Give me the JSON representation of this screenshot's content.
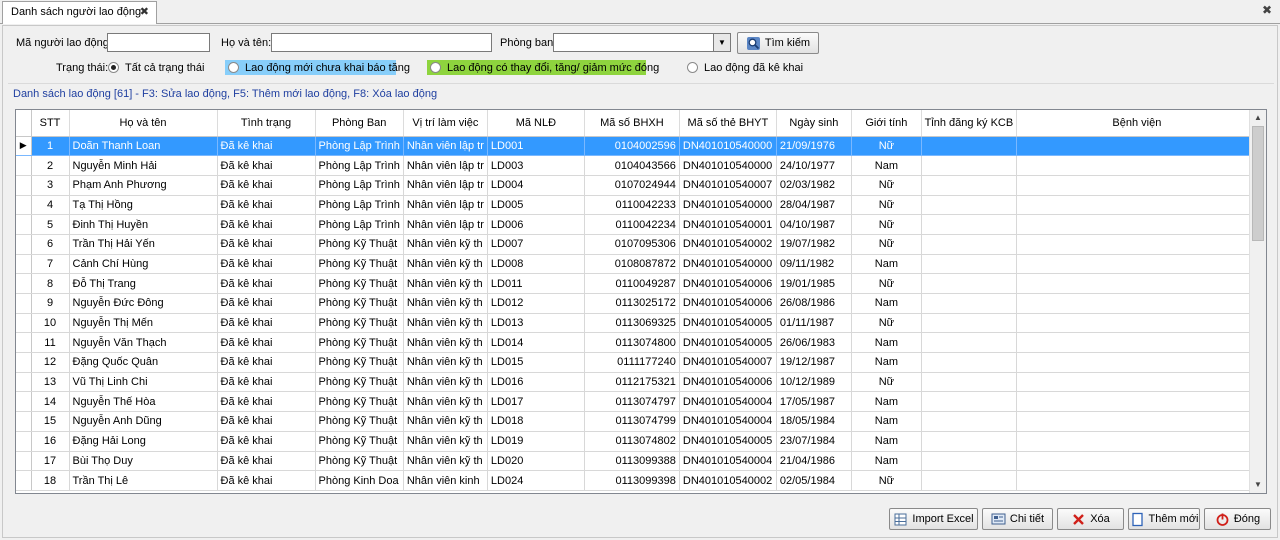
{
  "tab": {
    "title": "Danh sách người lao động",
    "close": "✖"
  },
  "window_close": "✖",
  "filters": {
    "employee_code_label": "Mã người lao động:",
    "employee_code_value": "",
    "name_label": "Họ và tên:",
    "name_value": "",
    "department_label": "Phòng ban:",
    "department_value": "",
    "search_label": "Tìm kiếm",
    "status_label": "Trạng thái:",
    "status_options": [
      {
        "label": "Tất cả trạng thái",
        "checked": true,
        "bg": ""
      },
      {
        "label": "Lao động mới chưa khai báo tăng",
        "checked": false,
        "bg": "#87cefa"
      },
      {
        "label": "Lao động có thay đổi, tăng/ giảm mức đóng",
        "checked": false,
        "bg": "#8ed43e"
      },
      {
        "label": "Lao động đã kê khai",
        "checked": false,
        "bg": ""
      }
    ]
  },
  "hint": "Danh sách lao động [61] - F3: Sửa lao động, F5: Thêm mới lao động, F8: Xóa lao động",
  "grid": {
    "columns": [
      "STT",
      "Họ và tên",
      "Tình trạng",
      "Phòng Ban",
      "Vị trí làm việc",
      "Mã NLĐ",
      "Mã số BHXH",
      "Mã số thẻ BHYT",
      "Ngày sinh",
      "Giới tính",
      "Tỉnh đăng ký KCB",
      "Bệnh viện"
    ],
    "selected_row_marker": "▶",
    "rows": [
      [
        "1",
        "Doãn Thanh Loan",
        "Đã kê khai",
        "Phòng Lập Trình",
        "Nhân viên lập tr",
        "LD001",
        "0104002596",
        "DN401010540000",
        "21/09/1976",
        "Nữ",
        "",
        ""
      ],
      [
        "2",
        "Nguyễn Minh Hải",
        "Đã kê khai",
        "Phòng Lập Trình",
        "Nhân viên lập tr",
        "LD003",
        "0104043566",
        "DN401010540000",
        "24/10/1977",
        "Nam",
        "",
        ""
      ],
      [
        "3",
        "Phạm Anh Phương",
        "Đã kê khai",
        "Phòng Lập Trình",
        "Nhân viên lập tr",
        "LD004",
        "0107024944",
        "DN401010540007",
        "02/03/1982",
        "Nữ",
        "",
        ""
      ],
      [
        "4",
        "Tạ Thị Hồng",
        "Đã kê khai",
        "Phòng Lập Trình",
        "Nhân viên lập tr",
        "LD005",
        "0110042233",
        "DN401010540000",
        "28/04/1987",
        "Nữ",
        "",
        ""
      ],
      [
        "5",
        "Đinh Thị Huyền",
        "Đã kê khai",
        "Phòng Lập Trình",
        "Nhân viên lập tr",
        "LD006",
        "0110042234",
        "DN401010540001",
        "04/10/1987",
        "Nữ",
        "",
        ""
      ],
      [
        "6",
        "Trần Thị Hải Yến",
        "Đã kê khai",
        "Phòng Kỹ Thuật",
        "Nhân viên kỹ th",
        "LD007",
        "0107095306",
        "DN401010540002",
        "19/07/1982",
        "Nữ",
        "",
        ""
      ],
      [
        "7",
        "Cảnh Chí Hùng",
        "Đã kê khai",
        "Phòng Kỹ Thuật",
        "Nhân viên kỹ th",
        "LD008",
        "0108087872",
        "DN401010540000",
        "09/11/1982",
        "Nam",
        "",
        ""
      ],
      [
        "8",
        "Đỗ Thị Trang",
        "Đã kê khai",
        "Phòng Kỹ Thuật",
        "Nhân viên kỹ th",
        "LD011",
        "0110049287",
        "DN401010540006",
        "19/01/1985",
        "Nữ",
        "",
        ""
      ],
      [
        "9",
        "Nguyễn Đức Đông",
        "Đã kê khai",
        "Phòng Kỹ Thuật",
        "Nhân viên kỹ th",
        "LD012",
        "0113025172",
        "DN401010540006",
        "26/08/1986",
        "Nam",
        "",
        ""
      ],
      [
        "10",
        "Nguyễn Thị Mến",
        "Đã kê khai",
        "Phòng Kỹ Thuật",
        "Nhân viên kỹ th",
        "LD013",
        "0113069325",
        "DN401010540005",
        "01/11/1987",
        "Nữ",
        "",
        ""
      ],
      [
        "11",
        "Nguyễn Văn Thạch",
        "Đã kê khai",
        "Phòng Kỹ Thuật",
        "Nhân viên kỹ th",
        "LD014",
        "0113074800",
        "DN401010540005",
        "26/06/1983",
        "Nam",
        "",
        ""
      ],
      [
        "12",
        "Đặng Quốc Quân",
        "Đã kê khai",
        "Phòng Kỹ Thuật",
        "Nhân viên kỹ th",
        "LD015",
        "0111177240",
        "DN401010540007",
        "19/12/1987",
        "Nam",
        "",
        ""
      ],
      [
        "13",
        "Vũ Thị Linh Chi",
        "Đã kê khai",
        "Phòng Kỹ Thuật",
        "Nhân viên kỹ th",
        "LD016",
        "0112175321",
        "DN401010540006",
        "10/12/1989",
        "Nữ",
        "",
        ""
      ],
      [
        "14",
        "Nguyễn Thế Hòa",
        "Đã kê khai",
        "Phòng Kỹ Thuật",
        "Nhân viên kỹ th",
        "LD017",
        "0113074797",
        "DN401010540004",
        "17/05/1987",
        "Nam",
        "",
        ""
      ],
      [
        "15",
        "Nguyễn Anh Dũng",
        "Đã kê khai",
        "Phòng Kỹ Thuật",
        "Nhân viên kỹ th",
        "LD018",
        "0113074799",
        "DN401010540004",
        "18/05/1984",
        "Nam",
        "",
        ""
      ],
      [
        "16",
        "Đặng Hải Long",
        "Đã kê khai",
        "Phòng Kỹ Thuật",
        "Nhân viên kỹ th",
        "LD019",
        "0113074802",
        "DN401010540005",
        "23/07/1984",
        "Nam",
        "",
        ""
      ],
      [
        "17",
        "Bùi Thọ Duy",
        "Đã kê khai",
        "Phòng Kỹ Thuật",
        "Nhân viên kỹ th",
        "LD020",
        "0113099388",
        "DN401010540004",
        "21/04/1986",
        "Nam",
        "",
        ""
      ],
      [
        "18",
        "Trần Thị Lê",
        "Đã kê khai",
        "Phòng Kinh Doa",
        "Nhân viên kinh",
        "LD024",
        "0113099398",
        "DN401010540002",
        "02/05/1984",
        "Nữ",
        "",
        ""
      ]
    ],
    "selected_index": 0,
    "scroll_up": "▲",
    "scroll_down": "▼"
  },
  "actions": {
    "import_excel": "Import Excel",
    "detail": "Chi tiết",
    "delete": "Xóa",
    "add_new": "Thêm mới",
    "close": "Đóng"
  },
  "colors": {
    "selection": "#3399ff",
    "hint_text": "#1f3fa0",
    "new_status_bg": "#87cefa",
    "changed_status_bg": "#8ed43e"
  }
}
